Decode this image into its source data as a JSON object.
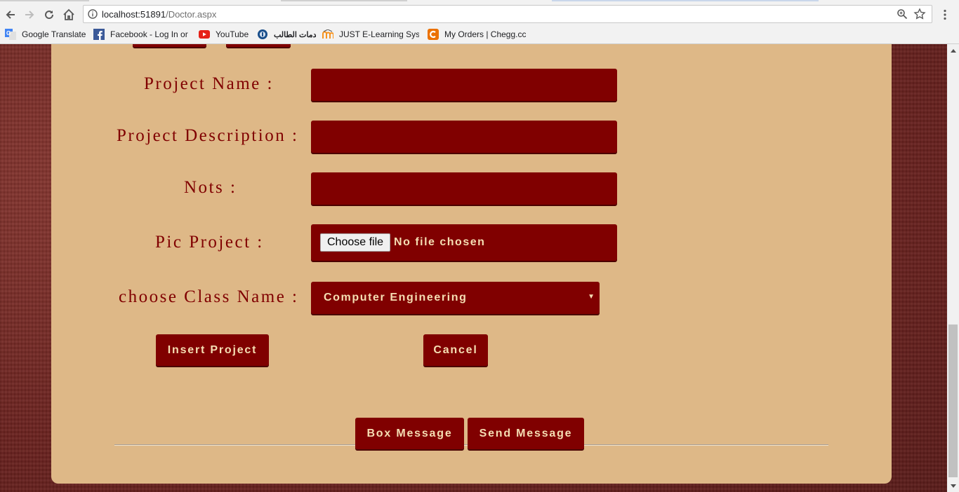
{
  "browser": {
    "url_host": "localhost:51891",
    "url_path": "/Doctor.aspx",
    "bookmarks": [
      {
        "label": "Google Translate",
        "icon": "google-translate-icon"
      },
      {
        "label": "Facebook - Log In or",
        "icon": "facebook-icon"
      },
      {
        "label": "YouTube",
        "icon": "youtube-icon"
      },
      {
        "label": "خدمات الطالب",
        "icon": "university-seal-icon"
      },
      {
        "label": "JUST E-Learning Syste",
        "icon": "moodle-icon"
      },
      {
        "label": "My Orders | Chegg.cc",
        "icon": "chegg-icon"
      }
    ]
  },
  "form": {
    "project_name_label": "Project Name :",
    "project_description_label": "Project Description :",
    "notes_label": "Nots :",
    "pic_label": "Pic Project :",
    "class_label": "choose Class Name :",
    "project_name_value": "",
    "project_description_value": "",
    "notes_value": "",
    "file_button": "Choose file",
    "file_status": "No file chosen",
    "class_selected": "Computer Engineering",
    "insert_button": "Insert Project",
    "cancel_button": "Cancel"
  },
  "footer": {
    "box_message_button": "Box Message",
    "send_message_button": "Send Message"
  },
  "colors": {
    "panel": "#deb887",
    "accent": "#800000",
    "accent_text": "#f5deb3"
  }
}
